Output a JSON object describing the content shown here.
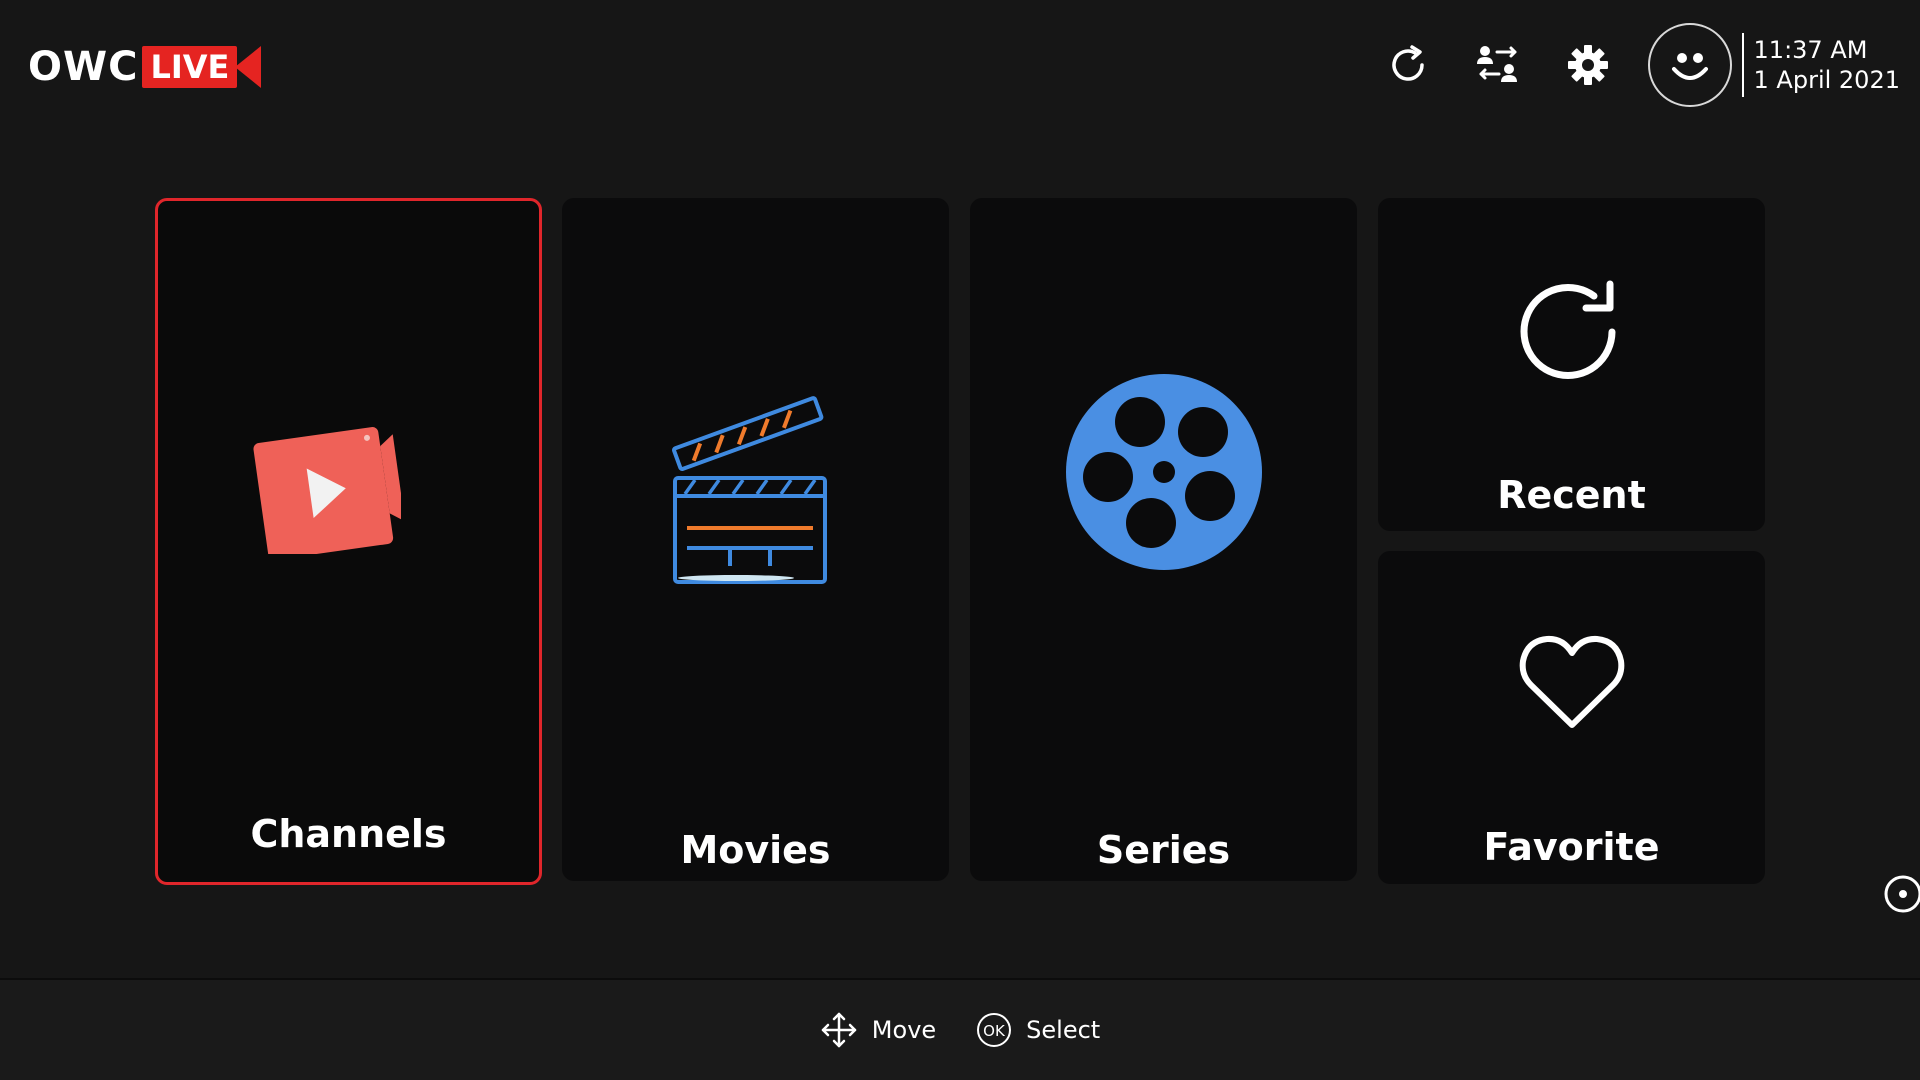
{
  "brand": {
    "name_part1": "OWC",
    "name_part2": "LIVE",
    "accent": "#e52421"
  },
  "header": {
    "icons": [
      "refresh-icon",
      "switch-user-icon",
      "settings-icon"
    ],
    "avatar_icon": "smiley-avatar-icon",
    "time": "11:37 AM",
    "date": "1 April 2021"
  },
  "tiles": [
    {
      "label": "Channels",
      "icon": "play-video-icon",
      "selected": true
    },
    {
      "label": "Movies",
      "icon": "clapperboard-icon",
      "selected": false
    },
    {
      "label": "Series",
      "icon": "film-reel-icon",
      "selected": false
    },
    {
      "label": "Recent",
      "icon": "refresh-icon",
      "selected": false
    },
    {
      "label": "Favorite",
      "icon": "heart-icon",
      "selected": false
    }
  ],
  "footer": {
    "move_label": "Move",
    "select_label": "Select",
    "ok_label": "OK"
  },
  "colors": {
    "background": "#161616",
    "tile": "#0b0b0c",
    "selection_border": "#e0262b",
    "channels_icon": "#ef6158",
    "movies_icon_blue": "#3f8ae0",
    "movies_icon_orange": "#f07b2c",
    "series_icon": "#4a8fe3"
  }
}
